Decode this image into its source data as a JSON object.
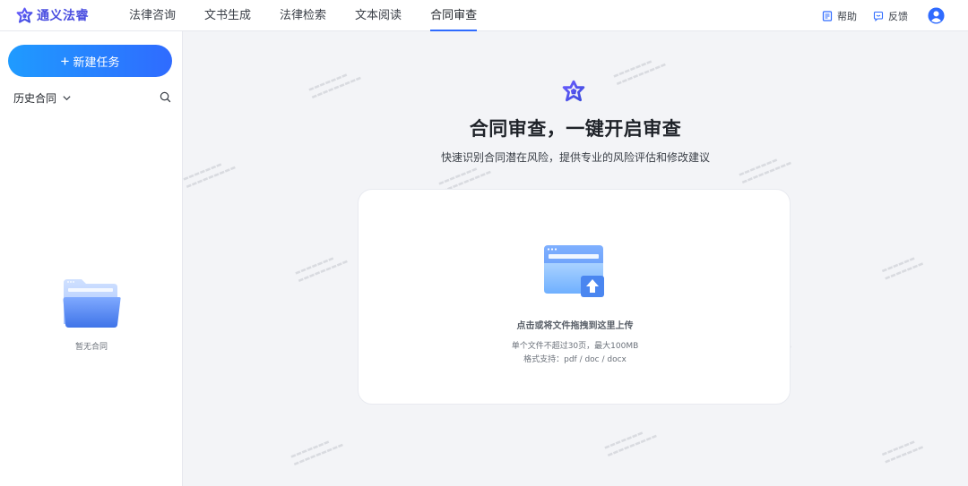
{
  "brand": {
    "name": "通义法睿"
  },
  "nav": {
    "items": [
      {
        "label": "法律咨询",
        "active": false
      },
      {
        "label": "文书生成",
        "active": false
      },
      {
        "label": "法律检索",
        "active": false
      },
      {
        "label": "文本阅读",
        "active": false
      },
      {
        "label": "合同审查",
        "active": true
      }
    ]
  },
  "header": {
    "help_label": "帮助",
    "feedback_label": "反馈"
  },
  "sidebar": {
    "new_task_label": "新建任务",
    "history_label": "历史合同",
    "empty_text": "暂无合同"
  },
  "main": {
    "headline": "合同审查，一键开启审查",
    "subline": "快速识别合同潜在风险，提供专业的风险评估和修改建议",
    "upload": {
      "main_text": "点击或将文件拖拽到这里上传",
      "limit_text": "单个文件不超过30页，最大100MB",
      "format_text": "格式支持：pdf / doc / docx"
    }
  },
  "colors": {
    "accent": "#2f6bff",
    "brand": "#4a4ee0",
    "button_gradient_start": "#1f9bff",
    "button_gradient_end": "#2f6bff"
  },
  "icons": {
    "brand_logo": "tongyi-logo-icon",
    "help": "document-icon",
    "feedback": "chat-icon",
    "avatar": "user-avatar-icon",
    "search": "search-icon",
    "chevron": "chevron-down-icon",
    "empty_folder": "folder-icon",
    "upload_folder": "upload-folder-icon"
  }
}
